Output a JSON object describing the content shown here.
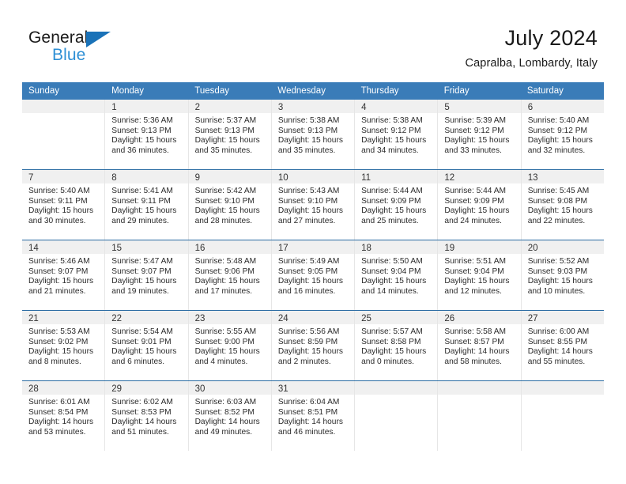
{
  "brand": {
    "name_dark": "General",
    "name_blue": "Blue",
    "accent_blue": "#2d8fd5",
    "triangle_blue": "#1a72b8"
  },
  "header": {
    "title": "July 2024",
    "subtitle": "Capralba, Lombardy, Italy"
  },
  "theme": {
    "header_bg": "#3a7cb8",
    "header_text": "#ffffff",
    "week_rule": "#2b6ca3",
    "day_band_bg": "#f0f0f0",
    "cell_border": "#e6e6e6",
    "body_text": "#2b2b2b"
  },
  "weekdays": [
    "Sunday",
    "Monday",
    "Tuesday",
    "Wednesday",
    "Thursday",
    "Friday",
    "Saturday"
  ],
  "weeks": [
    [
      {
        "day": "",
        "sunrise": "",
        "sunset": "",
        "daylight_1": "",
        "daylight_2": ""
      },
      {
        "day": "1",
        "sunrise": "Sunrise: 5:36 AM",
        "sunset": "Sunset: 9:13 PM",
        "daylight_1": "Daylight: 15 hours",
        "daylight_2": "and 36 minutes."
      },
      {
        "day": "2",
        "sunrise": "Sunrise: 5:37 AM",
        "sunset": "Sunset: 9:13 PM",
        "daylight_1": "Daylight: 15 hours",
        "daylight_2": "and 35 minutes."
      },
      {
        "day": "3",
        "sunrise": "Sunrise: 5:38 AM",
        "sunset": "Sunset: 9:13 PM",
        "daylight_1": "Daylight: 15 hours",
        "daylight_2": "and 35 minutes."
      },
      {
        "day": "4",
        "sunrise": "Sunrise: 5:38 AM",
        "sunset": "Sunset: 9:12 PM",
        "daylight_1": "Daylight: 15 hours",
        "daylight_2": "and 34 minutes."
      },
      {
        "day": "5",
        "sunrise": "Sunrise: 5:39 AM",
        "sunset": "Sunset: 9:12 PM",
        "daylight_1": "Daylight: 15 hours",
        "daylight_2": "and 33 minutes."
      },
      {
        "day": "6",
        "sunrise": "Sunrise: 5:40 AM",
        "sunset": "Sunset: 9:12 PM",
        "daylight_1": "Daylight: 15 hours",
        "daylight_2": "and 32 minutes."
      }
    ],
    [
      {
        "day": "7",
        "sunrise": "Sunrise: 5:40 AM",
        "sunset": "Sunset: 9:11 PM",
        "daylight_1": "Daylight: 15 hours",
        "daylight_2": "and 30 minutes."
      },
      {
        "day": "8",
        "sunrise": "Sunrise: 5:41 AM",
        "sunset": "Sunset: 9:11 PM",
        "daylight_1": "Daylight: 15 hours",
        "daylight_2": "and 29 minutes."
      },
      {
        "day": "9",
        "sunrise": "Sunrise: 5:42 AM",
        "sunset": "Sunset: 9:10 PM",
        "daylight_1": "Daylight: 15 hours",
        "daylight_2": "and 28 minutes."
      },
      {
        "day": "10",
        "sunrise": "Sunrise: 5:43 AM",
        "sunset": "Sunset: 9:10 PM",
        "daylight_1": "Daylight: 15 hours",
        "daylight_2": "and 27 minutes."
      },
      {
        "day": "11",
        "sunrise": "Sunrise: 5:44 AM",
        "sunset": "Sunset: 9:09 PM",
        "daylight_1": "Daylight: 15 hours",
        "daylight_2": "and 25 minutes."
      },
      {
        "day": "12",
        "sunrise": "Sunrise: 5:44 AM",
        "sunset": "Sunset: 9:09 PM",
        "daylight_1": "Daylight: 15 hours",
        "daylight_2": "and 24 minutes."
      },
      {
        "day": "13",
        "sunrise": "Sunrise: 5:45 AM",
        "sunset": "Sunset: 9:08 PM",
        "daylight_1": "Daylight: 15 hours",
        "daylight_2": "and 22 minutes."
      }
    ],
    [
      {
        "day": "14",
        "sunrise": "Sunrise: 5:46 AM",
        "sunset": "Sunset: 9:07 PM",
        "daylight_1": "Daylight: 15 hours",
        "daylight_2": "and 21 minutes."
      },
      {
        "day": "15",
        "sunrise": "Sunrise: 5:47 AM",
        "sunset": "Sunset: 9:07 PM",
        "daylight_1": "Daylight: 15 hours",
        "daylight_2": "and 19 minutes."
      },
      {
        "day": "16",
        "sunrise": "Sunrise: 5:48 AM",
        "sunset": "Sunset: 9:06 PM",
        "daylight_1": "Daylight: 15 hours",
        "daylight_2": "and 17 minutes."
      },
      {
        "day": "17",
        "sunrise": "Sunrise: 5:49 AM",
        "sunset": "Sunset: 9:05 PM",
        "daylight_1": "Daylight: 15 hours",
        "daylight_2": "and 16 minutes."
      },
      {
        "day": "18",
        "sunrise": "Sunrise: 5:50 AM",
        "sunset": "Sunset: 9:04 PM",
        "daylight_1": "Daylight: 15 hours",
        "daylight_2": "and 14 minutes."
      },
      {
        "day": "19",
        "sunrise": "Sunrise: 5:51 AM",
        "sunset": "Sunset: 9:04 PM",
        "daylight_1": "Daylight: 15 hours",
        "daylight_2": "and 12 minutes."
      },
      {
        "day": "20",
        "sunrise": "Sunrise: 5:52 AM",
        "sunset": "Sunset: 9:03 PM",
        "daylight_1": "Daylight: 15 hours",
        "daylight_2": "and 10 minutes."
      }
    ],
    [
      {
        "day": "21",
        "sunrise": "Sunrise: 5:53 AM",
        "sunset": "Sunset: 9:02 PM",
        "daylight_1": "Daylight: 15 hours",
        "daylight_2": "and 8 minutes."
      },
      {
        "day": "22",
        "sunrise": "Sunrise: 5:54 AM",
        "sunset": "Sunset: 9:01 PM",
        "daylight_1": "Daylight: 15 hours",
        "daylight_2": "and 6 minutes."
      },
      {
        "day": "23",
        "sunrise": "Sunrise: 5:55 AM",
        "sunset": "Sunset: 9:00 PM",
        "daylight_1": "Daylight: 15 hours",
        "daylight_2": "and 4 minutes."
      },
      {
        "day": "24",
        "sunrise": "Sunrise: 5:56 AM",
        "sunset": "Sunset: 8:59 PM",
        "daylight_1": "Daylight: 15 hours",
        "daylight_2": "and 2 minutes."
      },
      {
        "day": "25",
        "sunrise": "Sunrise: 5:57 AM",
        "sunset": "Sunset: 8:58 PM",
        "daylight_1": "Daylight: 15 hours",
        "daylight_2": "and 0 minutes."
      },
      {
        "day": "26",
        "sunrise": "Sunrise: 5:58 AM",
        "sunset": "Sunset: 8:57 PM",
        "daylight_1": "Daylight: 14 hours",
        "daylight_2": "and 58 minutes."
      },
      {
        "day": "27",
        "sunrise": "Sunrise: 6:00 AM",
        "sunset": "Sunset: 8:55 PM",
        "daylight_1": "Daylight: 14 hours",
        "daylight_2": "and 55 minutes."
      }
    ],
    [
      {
        "day": "28",
        "sunrise": "Sunrise: 6:01 AM",
        "sunset": "Sunset: 8:54 PM",
        "daylight_1": "Daylight: 14 hours",
        "daylight_2": "and 53 minutes."
      },
      {
        "day": "29",
        "sunrise": "Sunrise: 6:02 AM",
        "sunset": "Sunset: 8:53 PM",
        "daylight_1": "Daylight: 14 hours",
        "daylight_2": "and 51 minutes."
      },
      {
        "day": "30",
        "sunrise": "Sunrise: 6:03 AM",
        "sunset": "Sunset: 8:52 PM",
        "daylight_1": "Daylight: 14 hours",
        "daylight_2": "and 49 minutes."
      },
      {
        "day": "31",
        "sunrise": "Sunrise: 6:04 AM",
        "sunset": "Sunset: 8:51 PM",
        "daylight_1": "Daylight: 14 hours",
        "daylight_2": "and 46 minutes."
      },
      {
        "day": "",
        "sunrise": "",
        "sunset": "",
        "daylight_1": "",
        "daylight_2": ""
      },
      {
        "day": "",
        "sunrise": "",
        "sunset": "",
        "daylight_1": "",
        "daylight_2": ""
      },
      {
        "day": "",
        "sunrise": "",
        "sunset": "",
        "daylight_1": "",
        "daylight_2": ""
      }
    ]
  ]
}
